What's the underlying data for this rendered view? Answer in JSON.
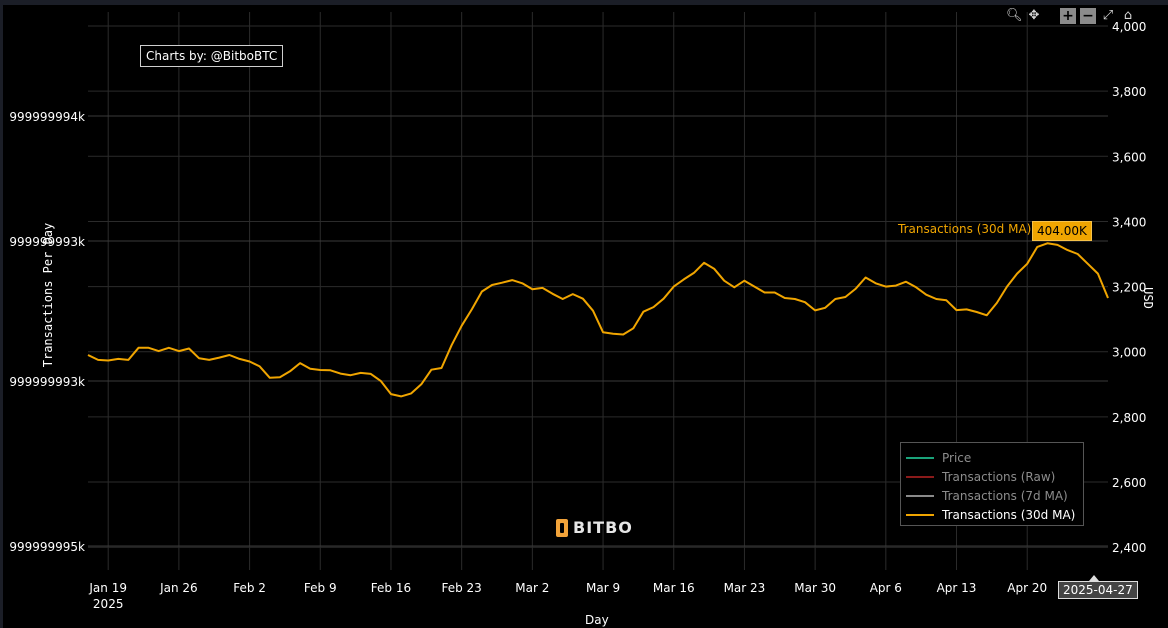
{
  "modebar": {
    "icons": [
      "zoom-icon",
      "pan-icon",
      "zoom-in-icon",
      "zoom-out-icon",
      "autoscale-icon",
      "reset-axes-icon"
    ]
  },
  "credit": "Charts by: @BitboBTC",
  "logo": "BITBO",
  "hover": {
    "series": "Transactions (30d MA)",
    "value": "404.00K",
    "date": "2025-04-27"
  },
  "legend": [
    {
      "name": "Price",
      "color": "#1aa37a",
      "dim": true
    },
    {
      "name": "Transactions (Raw)",
      "color": "#8b1a1a",
      "dim": true
    },
    {
      "name": "Transactions (7d MA)",
      "color": "#8a8a8a",
      "dim": true
    },
    {
      "name": "Transactions (30d MA)",
      "color": "#f0a500",
      "dim": false
    }
  ],
  "chart_data": {
    "type": "line",
    "xlabel": "Day",
    "ylabel_left": "Transactions Per Day",
    "ylabel_right": "USD",
    "x_ticks": [
      "Jan 19",
      "Jan 26",
      "Feb 2",
      "Feb 9",
      "Feb 16",
      "Feb 23",
      "Mar 2",
      "Mar 9",
      "Mar 16",
      "Mar 23",
      "Mar 30",
      "Apr 6",
      "Apr 13",
      "Apr 20"
    ],
    "x_tick_sub": "2025",
    "y_left_ticks": [
      "999999994k",
      "999999993k",
      "999999993k",
      "999999995k"
    ],
    "y_right_ticks": [
      "4,000",
      "3,800",
      "3,600",
      "3,400",
      "3,200",
      "3,000",
      "2,800",
      "2,600",
      "2,400"
    ],
    "y_right_range": [
      2330,
      4000
    ],
    "x_range": [
      "2025-01-17",
      "2025-04-28"
    ],
    "series": [
      {
        "name": "Transactions (30d MA)",
        "color": "#f0a500",
        "x": [
          "2025-01-17",
          "2025-01-18",
          "2025-01-19",
          "2025-01-20",
          "2025-01-21",
          "2025-01-22",
          "2025-01-23",
          "2025-01-24",
          "2025-01-25",
          "2025-01-26",
          "2025-01-27",
          "2025-01-28",
          "2025-01-29",
          "2025-01-30",
          "2025-01-31",
          "2025-02-01",
          "2025-02-02",
          "2025-02-03",
          "2025-02-04",
          "2025-02-05",
          "2025-02-06",
          "2025-02-07",
          "2025-02-08",
          "2025-02-09",
          "2025-02-10",
          "2025-02-11",
          "2025-02-12",
          "2025-02-13",
          "2025-02-14",
          "2025-02-15",
          "2025-02-16",
          "2025-02-17",
          "2025-02-18",
          "2025-02-19",
          "2025-02-20",
          "2025-02-21",
          "2025-02-22",
          "2025-02-23",
          "2025-02-24",
          "2025-02-25",
          "2025-02-26",
          "2025-02-27",
          "2025-02-28",
          "2025-03-01",
          "2025-03-02",
          "2025-03-03",
          "2025-03-04",
          "2025-03-05",
          "2025-03-06",
          "2025-03-07",
          "2025-03-08",
          "2025-03-09",
          "2025-03-10",
          "2025-03-11",
          "2025-03-12",
          "2025-03-13",
          "2025-03-14",
          "2025-03-15",
          "2025-03-16",
          "2025-03-17",
          "2025-03-18",
          "2025-03-19",
          "2025-03-20",
          "2025-03-21",
          "2025-03-22",
          "2025-03-23",
          "2025-03-24",
          "2025-03-25",
          "2025-03-26",
          "2025-03-27",
          "2025-03-28",
          "2025-03-29",
          "2025-03-30",
          "2025-03-31",
          "2025-04-01",
          "2025-04-02",
          "2025-04-03",
          "2025-04-04",
          "2025-04-05",
          "2025-04-06",
          "2025-04-07",
          "2025-04-08",
          "2025-04-09",
          "2025-04-10",
          "2025-04-11",
          "2025-04-12",
          "2025-04-13",
          "2025-04-14",
          "2025-04-15",
          "2025-04-16",
          "2025-04-17",
          "2025-04-18",
          "2025-04-19",
          "2025-04-20",
          "2025-04-21",
          "2025-04-22",
          "2025-04-23",
          "2025-04-24",
          "2025-04-25",
          "2025-04-26",
          "2025-04-27",
          "2025-04-28"
        ],
        "y": [
          2990,
          2975,
          2973,
          2978,
          2975,
          3012,
          3012,
          3002,
          3012,
          3002,
          3010,
          2980,
          2975,
          2982,
          2990,
          2978,
          2970,
          2955,
          2920,
          2922,
          2940,
          2965,
          2948,
          2944,
          2943,
          2933,
          2928,
          2935,
          2932,
          2910,
          2870,
          2863,
          2872,
          2900,
          2945,
          2950,
          3020,
          3080,
          3130,
          3185,
          3205,
          3212,
          3220,
          3210,
          3192,
          3196,
          3178,
          3162,
          3177,
          3163,
          3126,
          3060,
          3055,
          3053,
          3072,
          3123,
          3137,
          3163,
          3200,
          3222,
          3242,
          3273,
          3255,
          3218,
          3198,
          3218,
          3200,
          3182,
          3182,
          3165,
          3162,
          3152,
          3127,
          3135,
          3162,
          3168,
          3193,
          3228,
          3210,
          3200,
          3203,
          3215,
          3198,
          3175,
          3162,
          3158,
          3128,
          3130,
          3122,
          3112,
          3150,
          3200,
          3240,
          3270,
          3322,
          3333,
          3328,
          3312,
          3300,
          3270,
          3240,
          3165
        ]
      }
    ]
  }
}
